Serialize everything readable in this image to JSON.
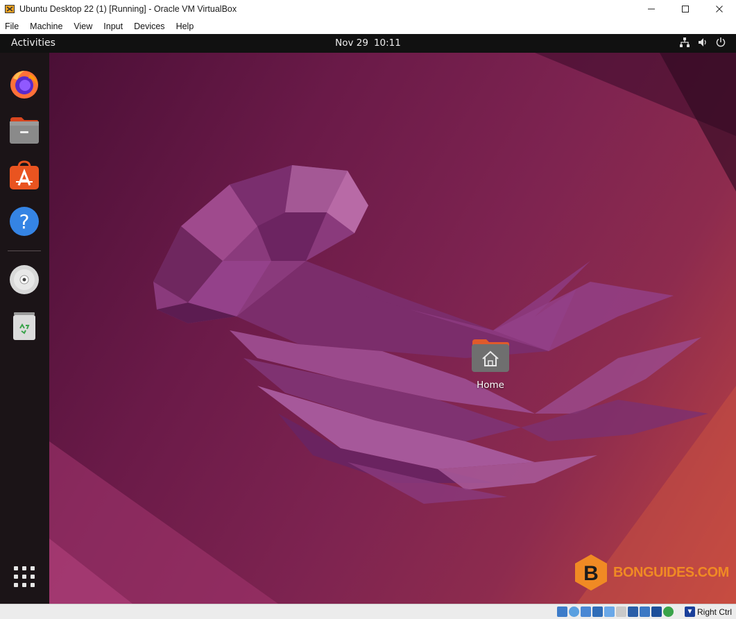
{
  "window": {
    "title": "Ubuntu Desktop 22 (1) [Running] - Oracle VM VirtualBox",
    "controls": [
      "minimize",
      "maximize",
      "close"
    ]
  },
  "menu": {
    "items": [
      "File",
      "Machine",
      "View",
      "Input",
      "Devices",
      "Help"
    ]
  },
  "topbar": {
    "activities": "Activities",
    "date": "Nov 29",
    "time": "10:11",
    "tray_icons": [
      "network-icon",
      "volume-icon",
      "power-icon"
    ]
  },
  "dock": {
    "items": [
      {
        "name": "Firefox",
        "icon": "firefox-icon"
      },
      {
        "name": "Files",
        "icon": "files-icon"
      },
      {
        "name": "Ubuntu Software",
        "icon": "software-icon"
      },
      {
        "name": "Help",
        "icon": "help-icon"
      },
      {
        "name": "Disc",
        "icon": "disc-icon"
      },
      {
        "name": "Trash",
        "icon": "trash-icon"
      }
    ],
    "show_apps_icon": "app-grid-icon"
  },
  "desktop": {
    "home_label": "Home"
  },
  "watermark": {
    "letter": "B",
    "text": "BONGUIDES.COM"
  },
  "statusbar": {
    "host_key": "Right Ctrl"
  },
  "colors": {
    "topbar": "#111111",
    "dock": "#1b1417",
    "watermark": "#f08a24"
  }
}
